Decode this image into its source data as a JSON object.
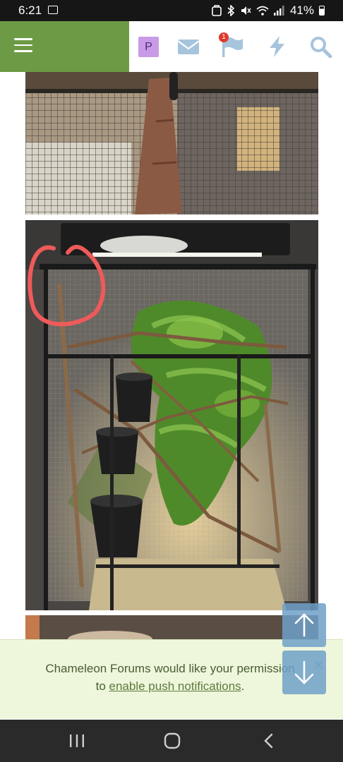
{
  "status_bar": {
    "time": "6:21",
    "battery": "41%",
    "icons": [
      "image-icon",
      "nfc-icon",
      "bluetooth-icon",
      "mute-icon",
      "wifi-icon",
      "signal-icon",
      "battery-icon"
    ]
  },
  "header": {
    "avatar_letter": "P",
    "alerts_badge": "1",
    "icons": [
      "menu-icon",
      "envelope-icon",
      "flag-icon",
      "bolt-icon",
      "search-icon"
    ],
    "brand_color": "#6d9a45",
    "icon_color": "#a7c4dd"
  },
  "push_notice": {
    "text_before": "Chameleon Forums would like your permission",
    "text_to": "to ",
    "link_text": "enable push notifications",
    "text_after": ".",
    "close_symbol": "✕"
  },
  "scroll_buttons": {
    "up_icon": "arrow-up-icon",
    "down_icon": "arrow-down-icon"
  },
  "nav_bar": {
    "icons": [
      "recents-icon",
      "home-icon",
      "back-icon"
    ]
  }
}
